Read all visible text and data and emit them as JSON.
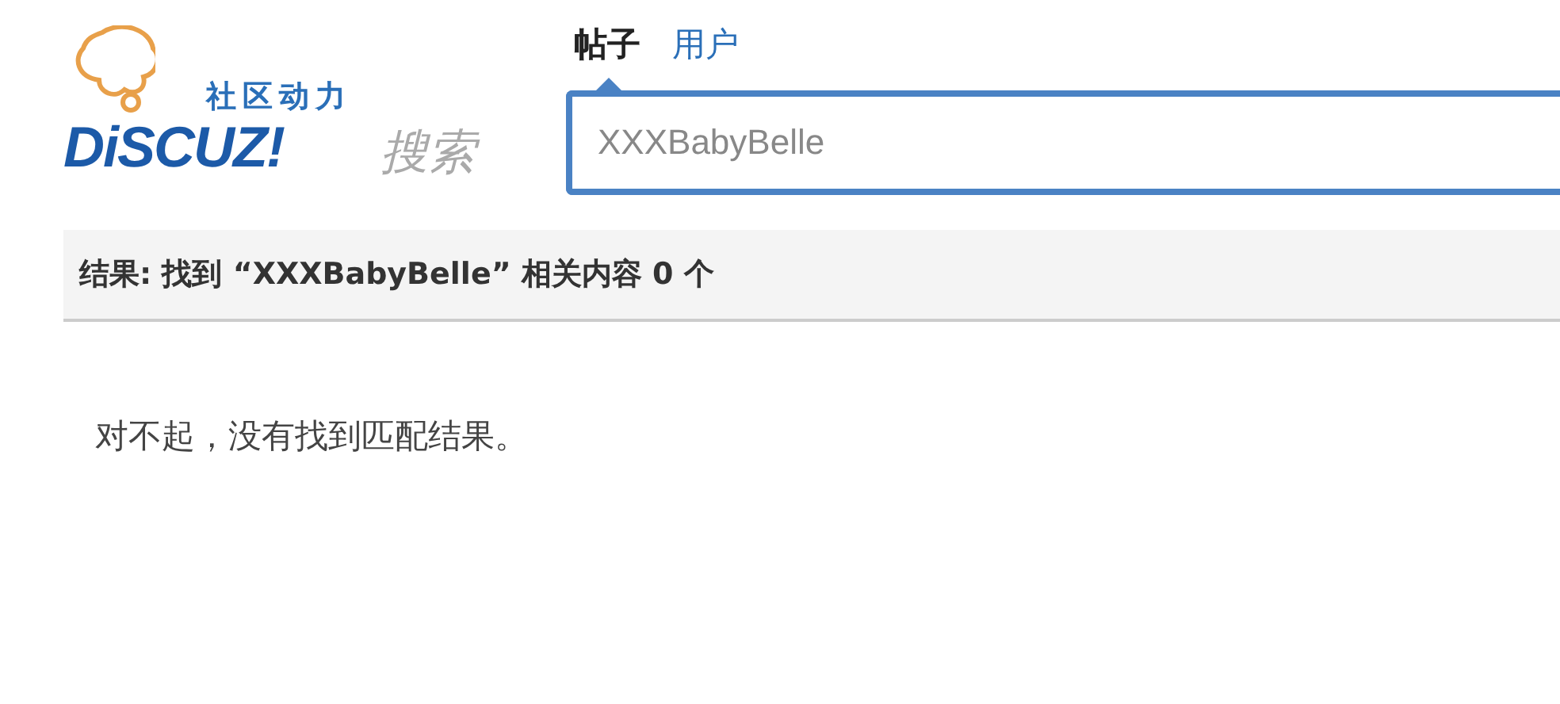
{
  "logo": {
    "tagline": "社区动力",
    "brand": "DiSCUZ!",
    "suffix": "搜索"
  },
  "tabs": [
    {
      "label": "帖子",
      "selected": true
    },
    {
      "label": "用户",
      "selected": false
    }
  ],
  "search": {
    "value": "XXXBabyBelle"
  },
  "result_bar": {
    "text": "结果: 找到 “XXXBabyBelle” 相关内容 0 个"
  },
  "message": "对不起，没有找到匹配结果。"
}
